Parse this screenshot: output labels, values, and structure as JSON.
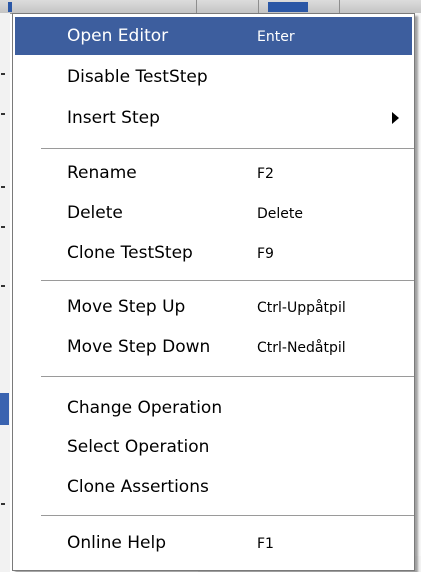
{
  "context_menu": {
    "items": [
      {
        "label": "Open Editor",
        "shortcut": "Enter",
        "selected": true
      },
      {
        "label": "Disable TestStep",
        "shortcut": ""
      },
      {
        "label": "Insert Step",
        "shortcut": "",
        "submenu": true
      },
      {
        "label": "Rename",
        "shortcut": "F2"
      },
      {
        "label": "Delete",
        "shortcut": "Delete"
      },
      {
        "label": "Clone TestStep",
        "shortcut": "F9"
      },
      {
        "label": "Move Step Up",
        "shortcut": "Ctrl-Uppåtpil"
      },
      {
        "label": "Move Step Down",
        "shortcut": "Ctrl-Nedåtpil"
      },
      {
        "label": "Change Operation",
        "shortcut": ""
      },
      {
        "label": "Select Operation",
        "shortcut": ""
      },
      {
        "label": "Clone Assertions",
        "shortcut": ""
      },
      {
        "label": "Online Help",
        "shortcut": "F1"
      }
    ],
    "colors": {
      "highlight": "#3d5e9e",
      "highlight_text": "#ffffff",
      "text": "#000000",
      "separator": "#9a9a9a"
    }
  }
}
